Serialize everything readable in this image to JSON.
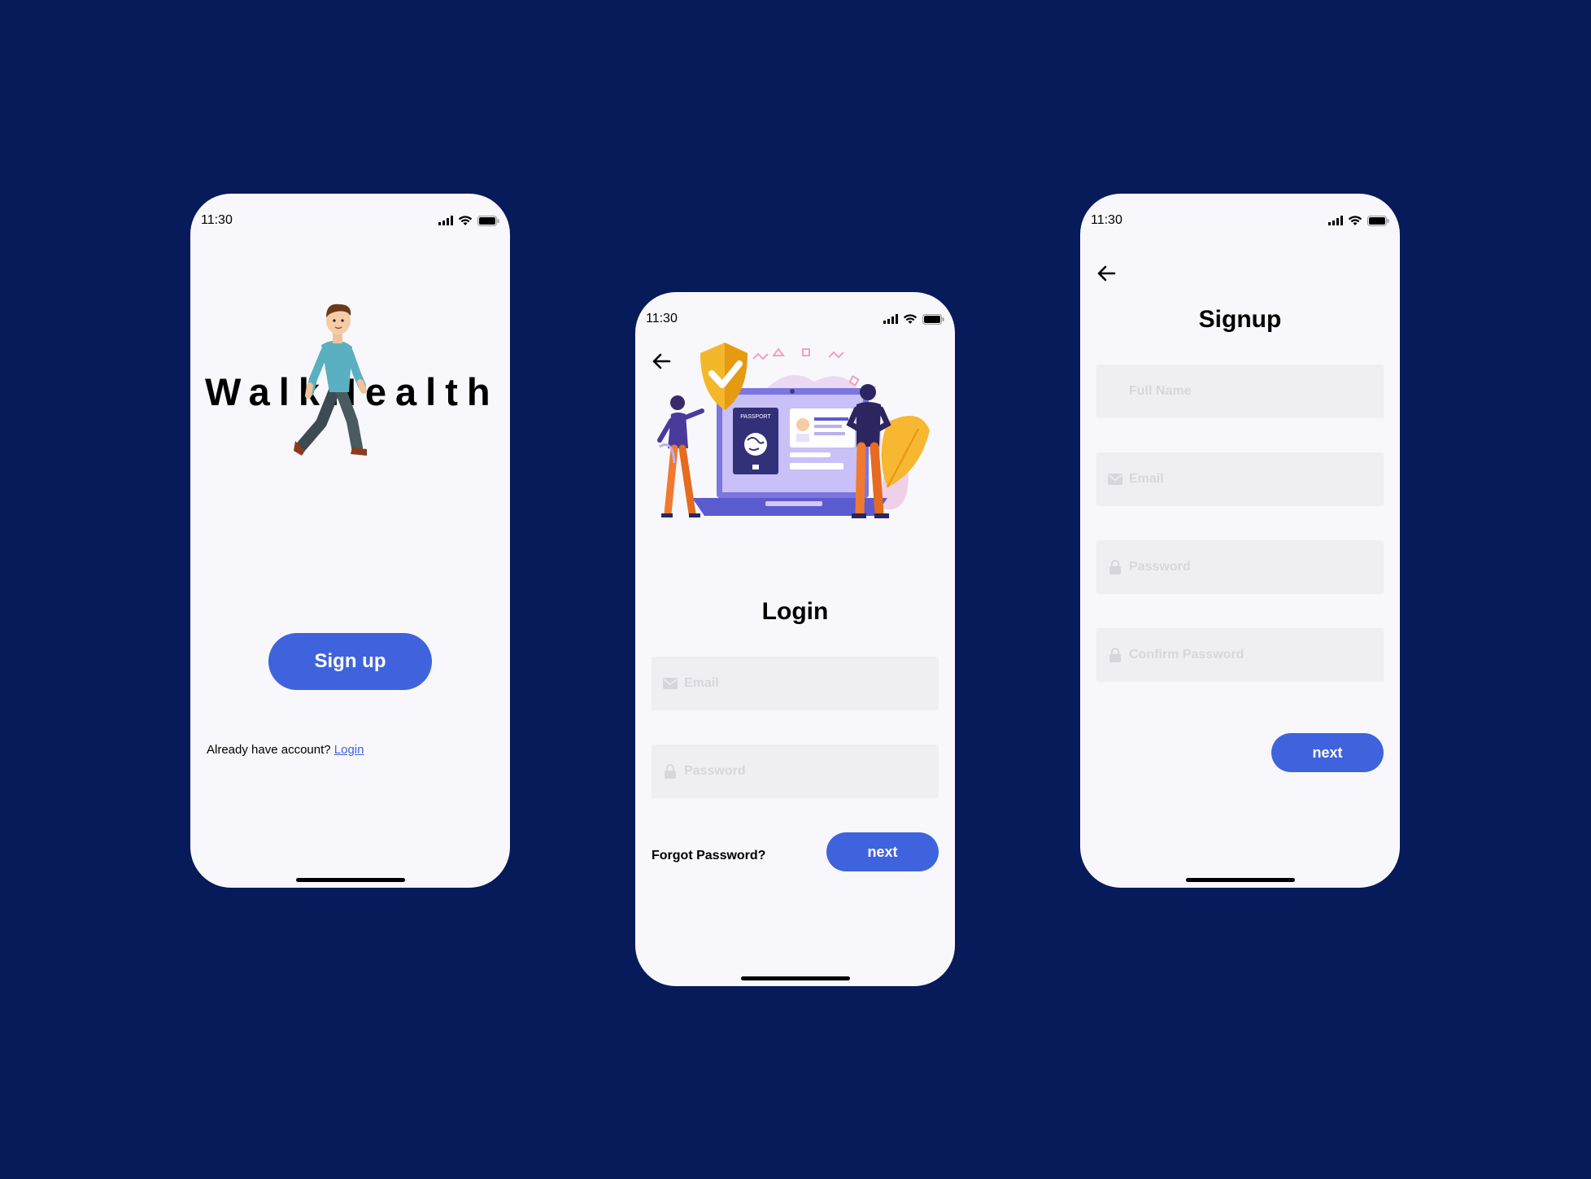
{
  "status_bar": {
    "time": "11:30"
  },
  "welcome": {
    "logo_text": "WalkHealth",
    "signup_label": "Sign up",
    "already_text": "Already have account?",
    "login_link": "Login"
  },
  "login": {
    "title": "Login",
    "email_placeholder": "Email",
    "password_placeholder": "Password",
    "forgot_label": "Forgot Password?",
    "next_label": "next",
    "illustration_label": "PASSPORT"
  },
  "signup": {
    "title": "Signup",
    "fullname_placeholder": "Full Name",
    "email_placeholder": "Email",
    "password_placeholder": "Password",
    "confirm_placeholder": "Confirm Password",
    "next_label": "next"
  },
  "colors": {
    "background": "#071a5a",
    "accent": "#3f63dc",
    "field": "#efeff3"
  }
}
